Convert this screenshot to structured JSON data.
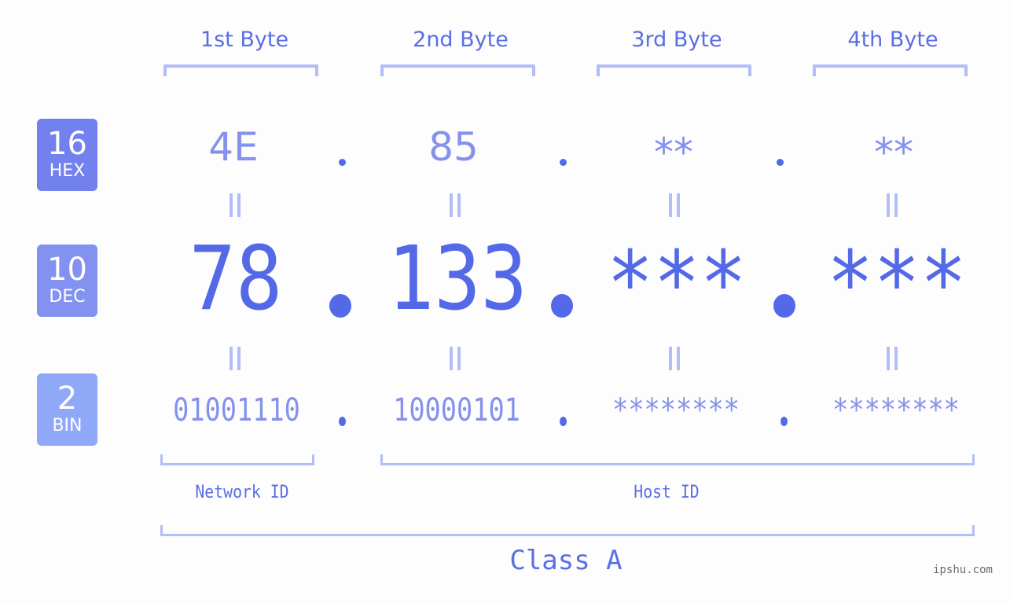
{
  "headers": [
    "1st Byte",
    "2nd Byte",
    "3rd Byte",
    "4th Byte"
  ],
  "badges": {
    "hex": {
      "number": "16",
      "label": "HEX",
      "color": "#7281ed"
    },
    "dec": {
      "number": "10",
      "label": "DEC",
      "color": "#8392f1"
    },
    "bin": {
      "number": "2",
      "label": "BIN",
      "color": "#8fa8f8"
    }
  },
  "hex": [
    "4E",
    "85",
    "**",
    "**"
  ],
  "dec": [
    "78",
    "133",
    "***",
    "***"
  ],
  "bin": [
    "01001110",
    "10000101",
    "********",
    "********"
  ],
  "labels": {
    "network": "Network ID",
    "host": "Host ID",
    "class": "Class A"
  },
  "watermark": "ipshu.com",
  "colors": {
    "primary": "#5469e8",
    "secondary": "#8591eb",
    "bracket": "#b3bdf7"
  }
}
